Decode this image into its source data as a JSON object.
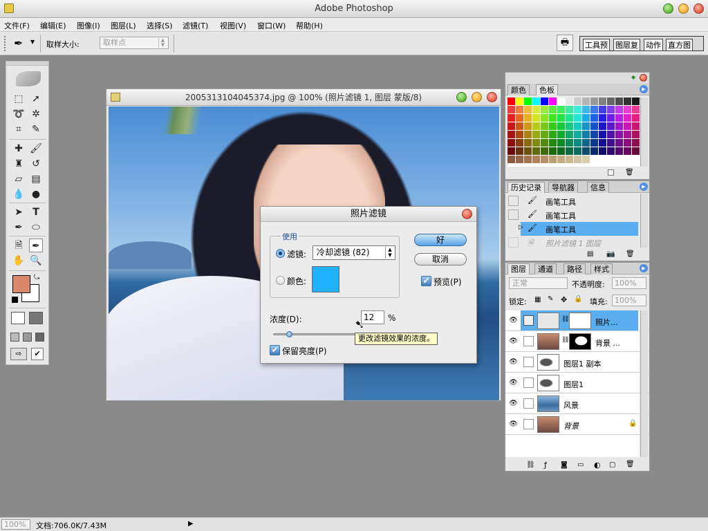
{
  "app": {
    "title": "Adobe Photoshop"
  },
  "menu": [
    "文件(F)",
    "编辑(E)",
    "图像(I)",
    "图层(L)",
    "选择(S)",
    "滤镜(T)",
    "视图(V)",
    "窗口(W)",
    "帮助(H)"
  ],
  "options": {
    "sample_label": "取样大小:",
    "sample_value": "取样点",
    "tabs": [
      "工具预",
      "图层复",
      "动作",
      "直方图"
    ]
  },
  "document": {
    "title": "2005313104045374.jpg @ 100% (照片滤镜 1, 图层 蒙版/8)"
  },
  "dialog": {
    "title": "照片滤镜",
    "use_group": "使用",
    "filter_label": "滤镜:",
    "filter_value": "冷却滤镜 (82)",
    "color_label": "颜色:",
    "color_swatch": "#1fb1ff",
    "ok": "好",
    "cancel": "取消",
    "preview": "预览(P)",
    "density_label": "浓度(D):",
    "density_value": "12",
    "density_unit": "%",
    "density_fraction": 0.12,
    "tooltip": "更改滤镜效果的浓度。",
    "preserve": "保留亮度(P)"
  },
  "color_panel": {
    "tabs": [
      "颜色",
      "色板"
    ]
  },
  "history_panel": {
    "tabs": [
      "历史记录",
      "导航器",
      "信息"
    ],
    "items": [
      "画笔工具",
      "画笔工具",
      "画笔工具",
      "照片滤镜 1 图层"
    ]
  },
  "layers_panel": {
    "tabs": [
      "图层",
      "通道",
      "路径",
      "样式"
    ],
    "blend": "正常",
    "opacity_label": "不透明度:",
    "opacity_value": "100%",
    "lock_label": "锁定:",
    "fill_label": "填充:",
    "fill_value": "100%",
    "layers": [
      "照片...",
      "背景 ...",
      "图层1 副本",
      "图层1",
      "风景",
      "背景"
    ]
  },
  "status": {
    "zoom": "100%",
    "doc": "文档:706.0K/7.43M"
  },
  "colors": {
    "foreground": "#d98a6a",
    "background": "#ffffff",
    "accent": "#5aaef0"
  }
}
